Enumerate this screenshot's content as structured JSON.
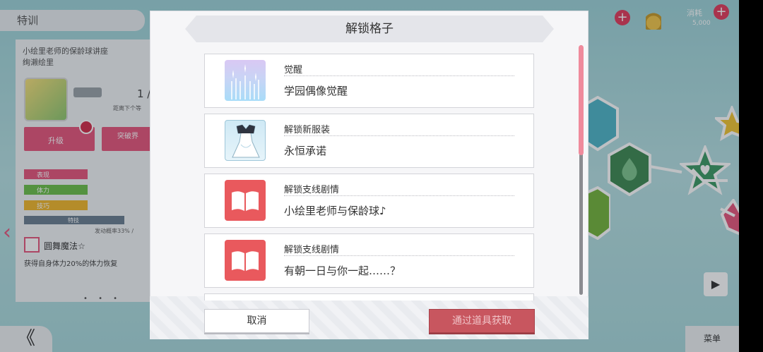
{
  "background": {
    "screen_title": "特训",
    "card_title_line1": "小绘里老师的保龄球讲座",
    "card_title_line2": "绚濑绘里",
    "lv_count": "1 /",
    "lv_sub": "距离下个等",
    "upgrade_button": "升级",
    "special_button": "突破界",
    "stats": [
      "表现",
      "体力",
      "技巧"
    ],
    "bar_label": "特技",
    "trigger_rate": "发动概率33% /",
    "skill_name": "圆舞魔法☆",
    "skill_desc": "获得自身体力20%的体力恢复",
    "page_dots": "• • •",
    "back_glyph": "《",
    "menu_button": "菜单",
    "hud_label": "消耗",
    "hud_value": "5,000",
    "colors": {
      "accent": "#e7567c",
      "teal": "#9ed3d8"
    }
  },
  "modal": {
    "title": "解锁格子",
    "items": [
      {
        "type": "觉醒",
        "name": "学园偶像觉醒",
        "icon": "awaken-sparkle-icon"
      },
      {
        "type": "解锁新服装",
        "name": "永恒承诺",
        "icon": "costume-dress-icon"
      },
      {
        "type": "解锁支线剧情",
        "name": "小绘里老师与保龄球♪",
        "icon": "story-book-icon"
      },
      {
        "type": "解锁支线剧情",
        "name": "有朝一日与你一起……？",
        "icon": "story-book-icon"
      }
    ],
    "cancel_label": "取消",
    "obtain_label": "通过道具获取",
    "colors": {
      "obtain_button": "#c8565f",
      "scroll_thumb": "#ef8a9c",
      "story_icon": "#e9595d"
    }
  }
}
